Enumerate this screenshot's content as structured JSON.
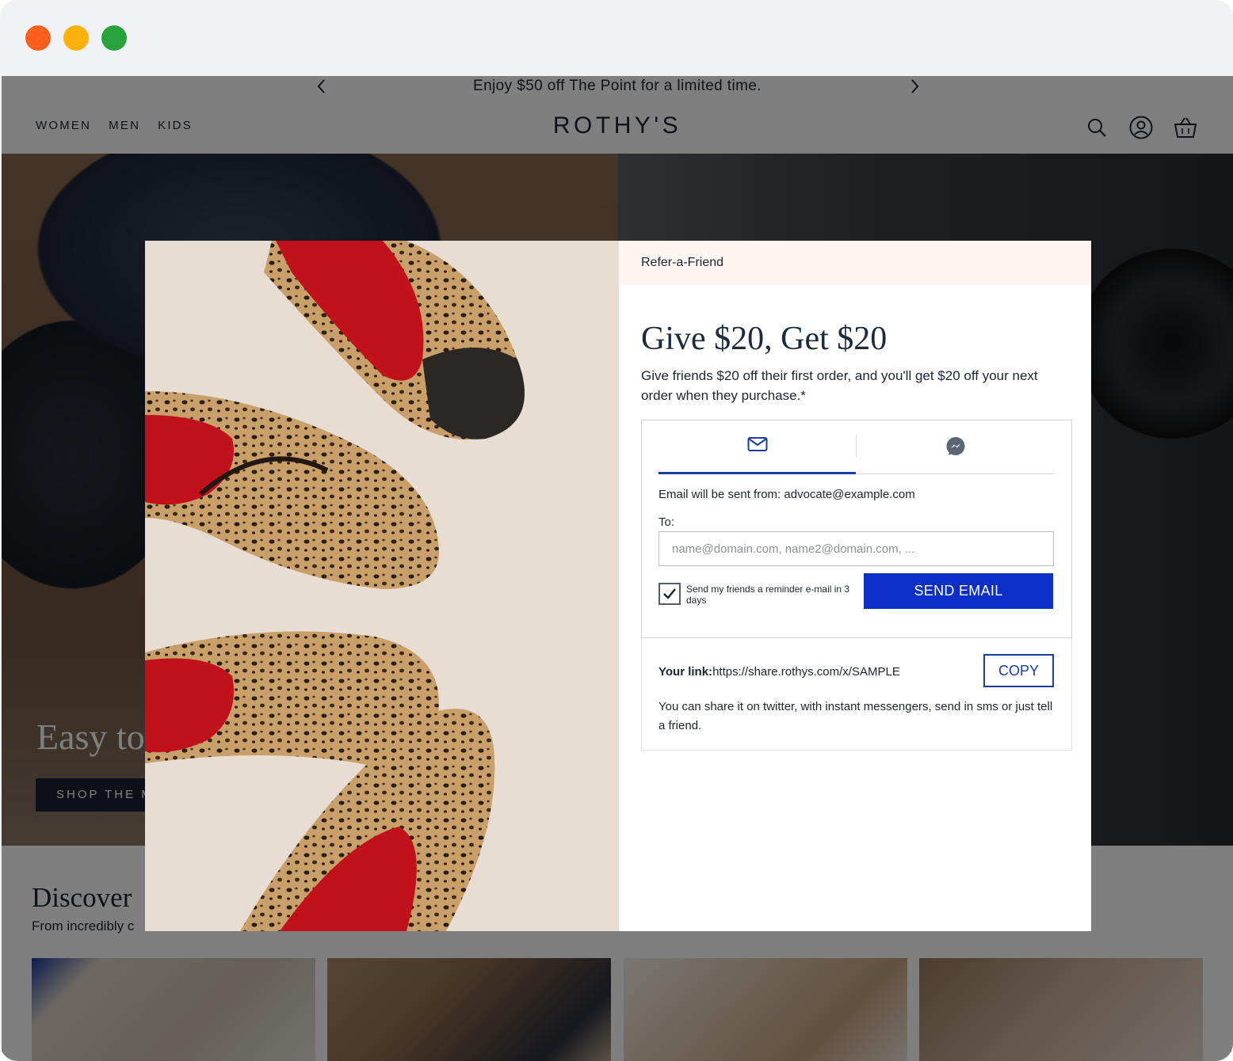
{
  "window": {
    "controls": [
      "close",
      "minimize",
      "maximize"
    ]
  },
  "announcement": {
    "text": "Enjoy $50 off The Point for a limited time.",
    "prev_icon": "chevron-left-icon",
    "next_icon": "chevron-right-icon"
  },
  "header": {
    "nav": [
      "WOMEN",
      "MEN",
      "KIDS"
    ],
    "logo": "ROTHY'S",
    "icons": [
      "search-icon",
      "account-icon",
      "cart-icon"
    ]
  },
  "hero": {
    "title": "Easy to",
    "cta": "SHOP THE M"
  },
  "discover": {
    "title": "Discover",
    "subtitle": "From incredibly c"
  },
  "modal": {
    "section_label": "Refer-a-Friend",
    "heading": "Give $20, Get $20",
    "description": "Give friends $20 off their first order, and you'll get $20 off your next order when they purchase.*",
    "tabs": [
      {
        "name": "email",
        "icon": "envelope-icon",
        "active": true
      },
      {
        "name": "messenger",
        "icon": "messenger-icon",
        "active": false
      }
    ],
    "from_text": "Email will be sent from: advocate@example.com",
    "to_label": "To:",
    "to_placeholder": "name@domain.com, name2@domain.com, ...",
    "to_value": "",
    "reminder_label": "Send my friends a reminder e-mail in 3 days",
    "reminder_checked": true,
    "send_label": "SEND EMAIL",
    "link_label": "Your link:",
    "link_url": "https://share.rothys.com/x/SAMPLE",
    "copy_label": "COPY",
    "share_note": "You can share it on twitter, with instant messengers, send in sms or just tell a friend."
  },
  "colors": {
    "brand_navy": "#1d2431",
    "primary_button": "#0b2fc7",
    "accent_blue": "#1a3da2",
    "modal_header_bg": "#fcf5f1"
  }
}
